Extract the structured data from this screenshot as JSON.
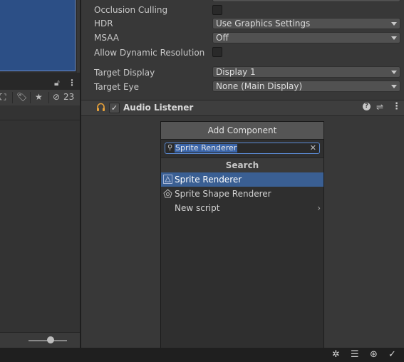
{
  "project_toolbar": {
    "hidden_count": "23"
  },
  "inspector": {
    "camera": {
      "occlusion_culling": {
        "label": "Occlusion Culling",
        "checked": false
      },
      "hdr": {
        "label": "HDR",
        "value": "Use Graphics Settings"
      },
      "msaa": {
        "label": "MSAA",
        "value": "Off"
      },
      "dynamic_resolution": {
        "label": "Allow Dynamic Resolution",
        "checked": false
      },
      "target_display": {
        "label": "Target Display",
        "value": "Display 1"
      },
      "target_eye": {
        "label": "Target Eye",
        "value": "None (Main Display)"
      }
    },
    "audio_listener": {
      "title": "Audio Listener",
      "enabled": true,
      "check_glyph": "✓"
    }
  },
  "add_component": {
    "title": "Add Component",
    "search_value": "Sprite Renderer",
    "section": "Search",
    "results": [
      {
        "label": "Sprite Renderer",
        "icon": "sprite-renderer-icon",
        "selected": true
      },
      {
        "label": "Sprite Shape Renderer",
        "icon": "sprite-shape-renderer-icon",
        "selected": false
      },
      {
        "label": "New script",
        "icon": "none",
        "selected": false,
        "submenu": true
      }
    ]
  },
  "colors": {
    "selection": "#3a5f93",
    "search_highlight": "#3a64a8",
    "scene_blue": "#2c4f86"
  }
}
